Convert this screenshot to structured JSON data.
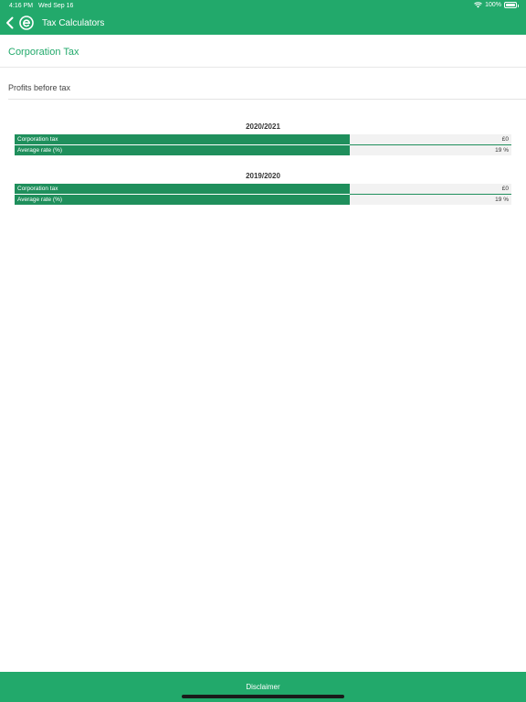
{
  "status_bar": {
    "time": "4:16 PM",
    "date": "Wed Sep 16",
    "battery": "100%"
  },
  "nav": {
    "title": "Tax Calculators"
  },
  "page": {
    "title": "Corporation Tax",
    "input_label": "Profits before tax"
  },
  "results": [
    {
      "year": "2020/2021",
      "rows": [
        {
          "label": "Corporation tax",
          "value": "£0"
        },
        {
          "label": "Average rate (%)",
          "value": "19 %"
        }
      ]
    },
    {
      "year": "2019/2020",
      "rows": [
        {
          "label": "Corporation tax",
          "value": "£0"
        },
        {
          "label": "Average rate (%)",
          "value": "19 %"
        }
      ]
    }
  ],
  "footer": {
    "disclaimer_label": "Disclaimer"
  },
  "colors": {
    "brand_green": "#22a96b",
    "row_green": "#1f8f5c"
  }
}
